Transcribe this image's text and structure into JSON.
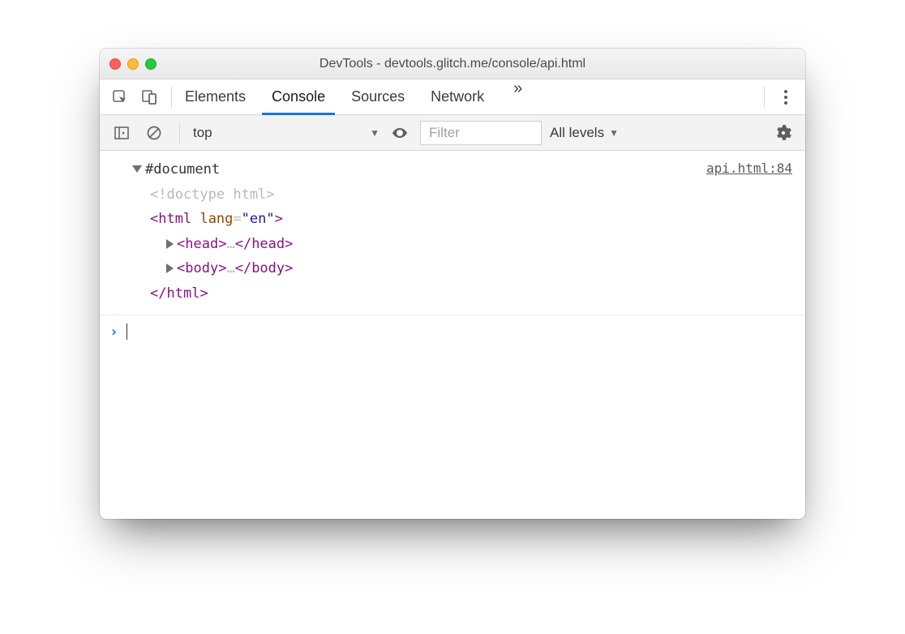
{
  "window": {
    "title": "DevTools - devtools.glitch.me/console/api.html"
  },
  "tabs": {
    "items": [
      "Elements",
      "Console",
      "Sources",
      "Network"
    ],
    "active": "Console"
  },
  "filterbar": {
    "context": "top",
    "filter_placeholder": "Filter",
    "levels_label": "All levels"
  },
  "console": {
    "source_link": "api.html:84",
    "tree": {
      "root": "#document",
      "doctype": "<!doctype html>",
      "html_open_tag": "html",
      "html_open_attr_name": "lang",
      "html_open_attr_value": "\"en\"",
      "head_open": "head",
      "head_ellipsis": "…",
      "head_close": "/head",
      "body_open": "body",
      "body_ellipsis": "…",
      "body_close": "/body",
      "html_close": "/html"
    }
  }
}
